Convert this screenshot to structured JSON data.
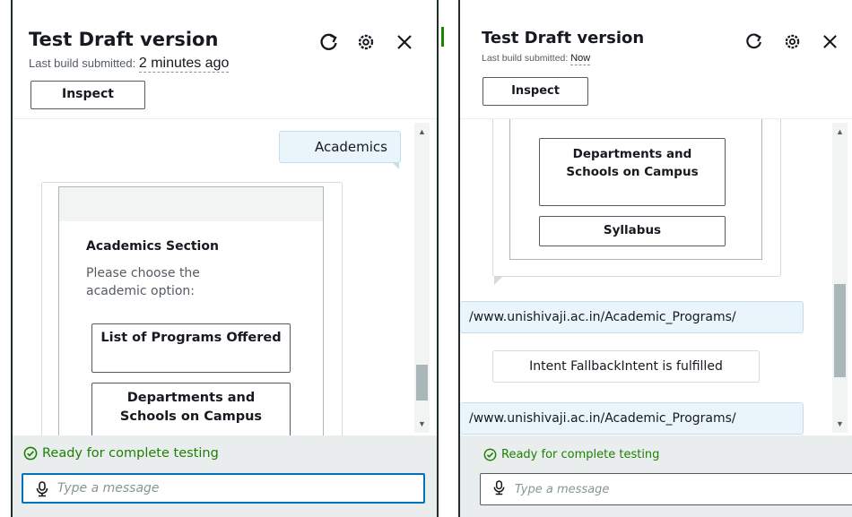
{
  "left_panel": {
    "title": "Test Draft version",
    "subtitle_label": "Last build submitted:",
    "subtitle_value": "2 minutes ago",
    "icons": [
      "refresh-icon",
      "settings-icon",
      "close-icon"
    ],
    "inspect_label": "Inspect",
    "user_message": "Academics",
    "card": {
      "title": "Academics Section",
      "text": "Please choose the academic option:",
      "buttons": [
        "List of Programs Offered",
        "Departments and Schools on Campus"
      ]
    },
    "status": "Ready for complete testing",
    "input_placeholder": "Type a message"
  },
  "right_panel": {
    "title": "Test Draft version",
    "subtitle_label": "Last build submitted:",
    "subtitle_value": "Now",
    "icons": [
      "refresh-icon",
      "settings-icon",
      "close-icon"
    ],
    "inspect_label": "Inspect",
    "card_buttons": [
      "Departments and Schools on Campus",
      "Syllabus"
    ],
    "messages": [
      "/www.unishivaji.ac.in/Academic_Programs/",
      "Intent FallbackIntent is fulfilled",
      "/www.unishivaji.ac.in/Academic_Programs/"
    ],
    "status": "Ready for complete testing",
    "input_placeholder": "Type a message"
  },
  "colors": {
    "status_green": "#1d8102",
    "focus_blue": "#0073bb",
    "user_bubble": "#e9f4fb",
    "footer_bg": "#eaeded"
  }
}
